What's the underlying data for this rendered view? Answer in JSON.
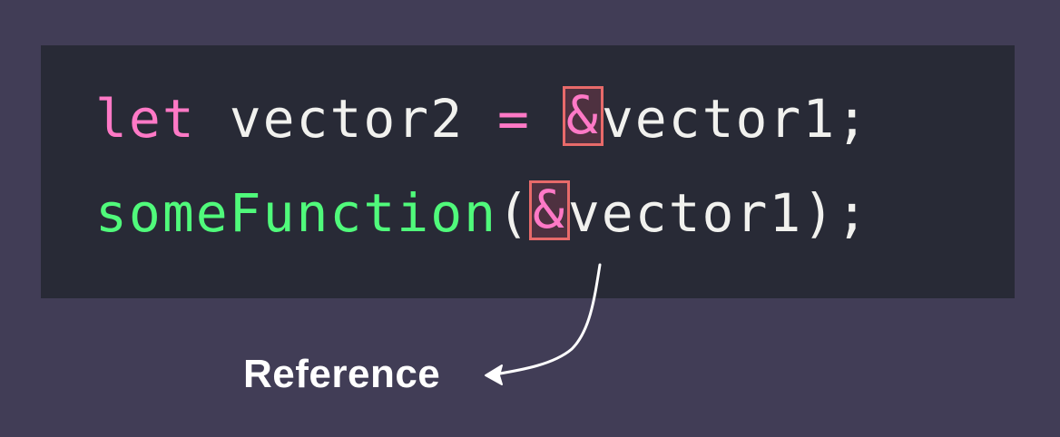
{
  "code": {
    "line1": {
      "keyword": "let",
      "variable": "vector2",
      "operator": "=",
      "ampersand": "&",
      "target": "vector1;"
    },
    "line2": {
      "function_name": "someFunction",
      "open_paren": "(",
      "ampersand": "&",
      "argument": "vector1",
      "close": ");"
    }
  },
  "annotation": {
    "label": "Reference"
  },
  "colors": {
    "background": "#413d56",
    "code_panel": "#282a36",
    "keyword": "#ff79c6",
    "function": "#50fa7b",
    "identifier": "#f1f1ee",
    "highlight_border": "#e86a6a"
  }
}
